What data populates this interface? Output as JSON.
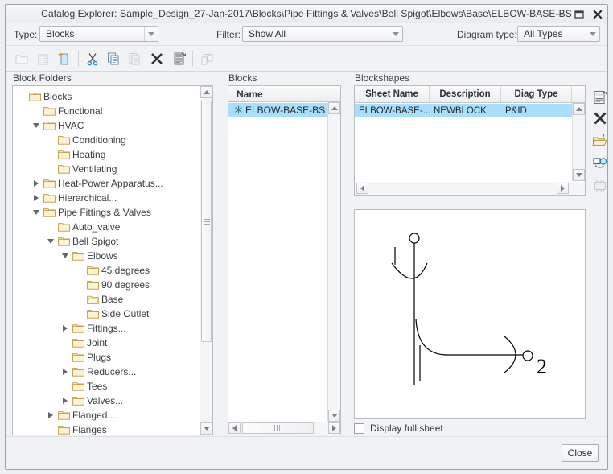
{
  "window": {
    "title": "Catalog Explorer: Sample_Design_27-Jan-2017\\Blocks\\Pipe Fittings & Valves\\Bell Spigot\\Elbows\\Base\\ELBOW-BASE-BS",
    "minimize_label": "minimize-icon",
    "maximize_label": "maximize-icon",
    "close_label": "close-icon"
  },
  "filterbar": {
    "type_label": "Type:",
    "type_value": "Blocks",
    "filter_label": "Filter:",
    "filter_value": "Show All",
    "diagram_label": "Diagram type:",
    "diagram_value": "All Types"
  },
  "toolbar": {
    "items": [
      {
        "name": "new-folder-icon",
        "enabled": false
      },
      {
        "name": "new-page-icon",
        "enabled": false
      },
      {
        "name": "new-block-icon",
        "enabled": true
      },
      {
        "name": "cut-icon",
        "enabled": true
      },
      {
        "name": "copy-icon",
        "enabled": true
      },
      {
        "name": "paste-icon",
        "enabled": false
      },
      {
        "name": "delete-icon",
        "enabled": true
      },
      {
        "name": "properties-icon",
        "enabled": true
      },
      {
        "name": "move-to-folder-icon",
        "enabled": false
      }
    ]
  },
  "tree": {
    "label": "Block Folders",
    "nodes": [
      {
        "label": "Blocks",
        "depth": 0,
        "toggle": "none",
        "icon": "folder"
      },
      {
        "label": "Functional",
        "depth": 1,
        "toggle": "none",
        "icon": "folder"
      },
      {
        "label": "HVAC",
        "depth": 1,
        "toggle": "open",
        "icon": "folder"
      },
      {
        "label": "Conditioning",
        "depth": 2,
        "toggle": "none",
        "icon": "folder"
      },
      {
        "label": "Heating",
        "depth": 2,
        "toggle": "none",
        "icon": "folder"
      },
      {
        "label": "Ventilating",
        "depth": 2,
        "toggle": "none",
        "icon": "folder"
      },
      {
        "label": "Heat-Power Apparatus...",
        "depth": 1,
        "toggle": "closed",
        "icon": "folder"
      },
      {
        "label": "Hierarchical...",
        "depth": 1,
        "toggle": "closed",
        "icon": "folder"
      },
      {
        "label": "Pipe Fittings & Valves",
        "depth": 1,
        "toggle": "open",
        "icon": "folder"
      },
      {
        "label": "Auto_valve",
        "depth": 2,
        "toggle": "none",
        "icon": "folder"
      },
      {
        "label": "Bell Spigot",
        "depth": 2,
        "toggle": "open",
        "icon": "folder"
      },
      {
        "label": "Elbows",
        "depth": 3,
        "toggle": "open",
        "icon": "folder"
      },
      {
        "label": "45 degrees",
        "depth": 4,
        "toggle": "none",
        "icon": "folder"
      },
      {
        "label": "90 degrees",
        "depth": 4,
        "toggle": "none",
        "icon": "folder"
      },
      {
        "label": "Base",
        "depth": 4,
        "toggle": "none",
        "icon": "folder-open"
      },
      {
        "label": "Side Outlet",
        "depth": 4,
        "toggle": "none",
        "icon": "folder"
      },
      {
        "label": "Fittings...",
        "depth": 3,
        "toggle": "closed",
        "icon": "folder"
      },
      {
        "label": "Joint",
        "depth": 3,
        "toggle": "none",
        "icon": "folder"
      },
      {
        "label": "Plugs",
        "depth": 3,
        "toggle": "none",
        "icon": "folder"
      },
      {
        "label": "Reducers...",
        "depth": 3,
        "toggle": "closed",
        "icon": "folder"
      },
      {
        "label": "Tees",
        "depth": 3,
        "toggle": "none",
        "icon": "folder"
      },
      {
        "label": "Valves...",
        "depth": 3,
        "toggle": "closed",
        "icon": "folder"
      },
      {
        "label": "Flanged...",
        "depth": 2,
        "toggle": "closed",
        "icon": "folder"
      },
      {
        "label": "Flanges",
        "depth": 2,
        "toggle": "none",
        "icon": "folder"
      }
    ]
  },
  "blocks": {
    "label": "Blocks",
    "column": "Name",
    "rows": [
      {
        "name": "ELBOW-BASE-BS",
        "selected": true,
        "icon": "asterisk-icon"
      }
    ]
  },
  "blockshapes": {
    "label": "Blockshapes",
    "columns": [
      "Sheet Name",
      "Description",
      "Diag Type"
    ],
    "rows": [
      {
        "sheet_name": "ELBOW-BASE-...",
        "description": "NEWBLOCK",
        "diag_type": "P&ID",
        "selected": true
      }
    ]
  },
  "side_buttons": [
    {
      "name": "edit-properties-icon",
      "enabled": true
    },
    {
      "name": "delete-x-icon",
      "enabled": true
    },
    {
      "name": "open-folder-icon",
      "enabled": true
    },
    {
      "name": "refresh-preview-icon",
      "enabled": true
    },
    {
      "name": "chip-icon",
      "enabled": false
    }
  ],
  "preview": {
    "name": "blockshape-preview",
    "display_full_sheet_label": "Display full sheet",
    "display_full_sheet_checked": false,
    "port_label_2": "2"
  },
  "footer": {
    "close_label": "Close"
  },
  "colors": {
    "selection": "#aadffb",
    "window_bg": "#f1f2f4",
    "border": "#b9bcc0",
    "folder_fill": "#f7e3b5",
    "folder_stroke": "#c8a84b"
  }
}
